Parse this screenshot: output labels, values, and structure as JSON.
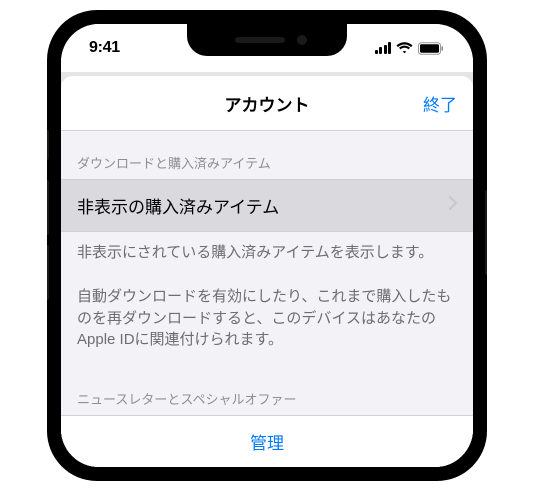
{
  "statusBar": {
    "time": "9:41"
  },
  "nav": {
    "title": "アカウント",
    "done": "終了"
  },
  "sections": {
    "downloads": {
      "header": "ダウンロードと購入済みアイテム",
      "hiddenPurchases": "非表示の購入済みアイテム",
      "footer1": "非表示にされている購入済みアイテムを表示します。",
      "footer2": "自動ダウンロードを有効にしたり、これまで購入したものを再ダウンロードすると、このデバイスはあなたのApple IDに関連付けられます。"
    },
    "newsletter": {
      "header": "ニュースレターとスペシャルオファー",
      "manage": "管理"
    }
  }
}
